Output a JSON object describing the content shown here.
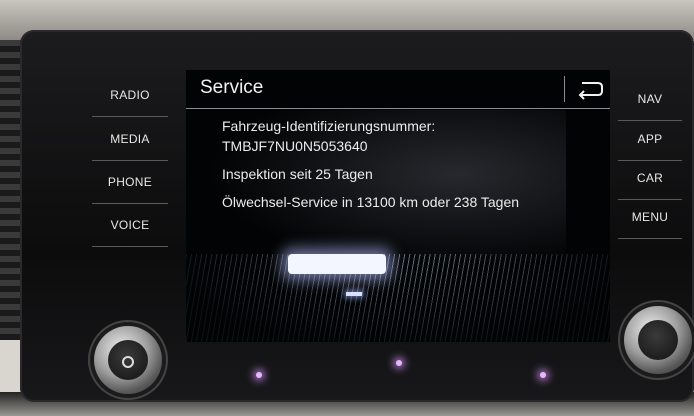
{
  "left_buttons": [
    "RADIO",
    "MEDIA",
    "PHONE",
    "VOICE"
  ],
  "right_buttons": [
    "NAV",
    "APP",
    "CAR",
    "MENU"
  ],
  "screen": {
    "title": "Service",
    "back_icon": "back-arrow-icon",
    "lines": [
      "Fahrzeug-Identifizierungsnummer:",
      "TMBJF7NU0N5053640",
      "Inspektion seit 25 Tagen",
      "Ölwechsel-Service in 13100 km oder 238 Tagen"
    ]
  },
  "knobs": [
    "power-volume-knob",
    "menu-knob"
  ]
}
